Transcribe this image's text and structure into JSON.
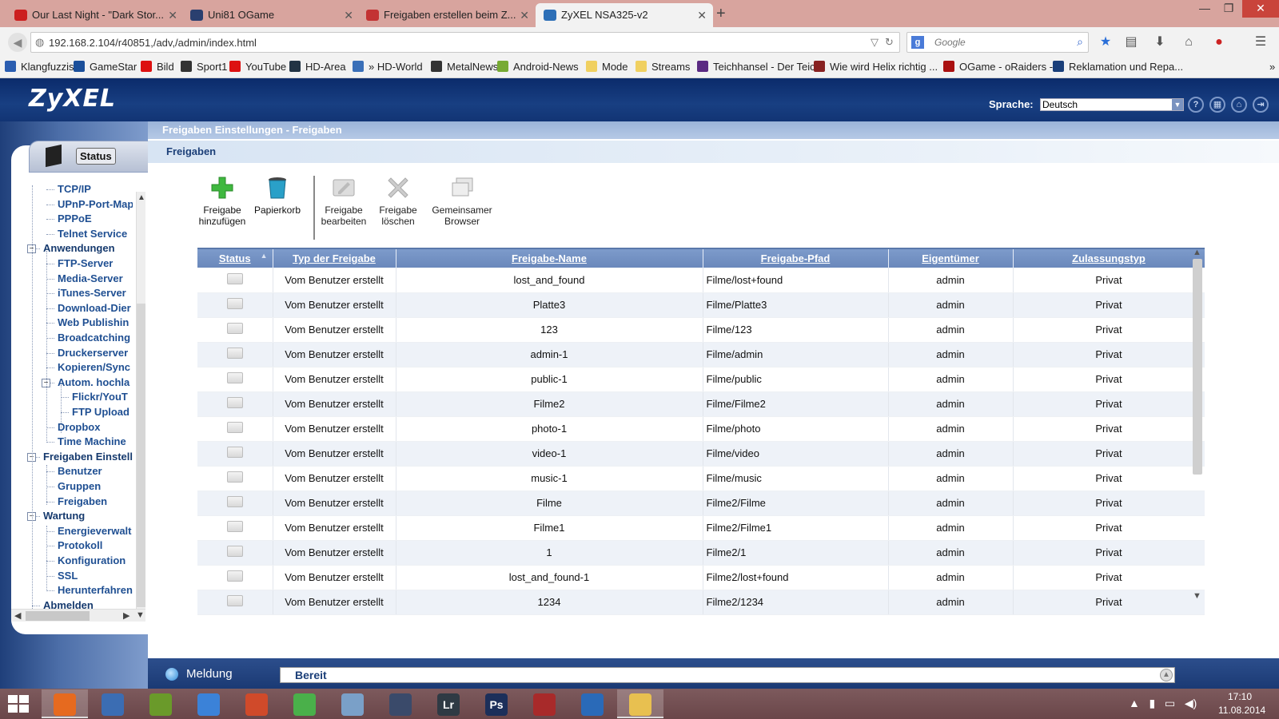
{
  "browser": {
    "tabs": [
      {
        "title": "Our Last Night - \"Dark Stor...",
        "favicon_color": "#cc1f1f"
      },
      {
        "title": "Uni81 OGame",
        "favicon_color": "#2a3f6f"
      },
      {
        "title": "Freigaben erstellen beim Z...",
        "favicon_color": "#c33333"
      },
      {
        "title": "ZyXEL NSA325-v2",
        "favicon_color": "#2d6fb7"
      }
    ],
    "url": "192.168.2.104/r40851,/adv,/admin/index.html",
    "search_placeholder": "Google",
    "bookmarks": [
      {
        "label": "Klangfuzzis",
        "color": "#2a5db0"
      },
      {
        "label": "GameStar",
        "color": "#1b4f9a"
      },
      {
        "label": "Bild",
        "color": "#d11"
      },
      {
        "label": "Sport1",
        "color": "#333"
      },
      {
        "label": "YouTube",
        "color": "#d11"
      },
      {
        "label": "HD-Area",
        "color": "#234"
      },
      {
        "label": "» HD-World",
        "color": "#3a6fb8"
      },
      {
        "label": "MetalNews",
        "color": "#333"
      },
      {
        "label": "Android-News",
        "color": "#7a3"
      },
      {
        "label": "Mode",
        "color": "#f0d060"
      },
      {
        "label": "Streams",
        "color": "#f0d060"
      },
      {
        "label": "Teichhansel - Der Teic...",
        "color": "#5a2a82"
      },
      {
        "label": "Wie wird Helix richtig ...",
        "color": "#822"
      },
      {
        "label": "OGame - oRaiders -",
        "color": "#a11"
      },
      {
        "label": "Reklamation und Repa...",
        "color": "#1a3f7a"
      }
    ]
  },
  "header": {
    "logo": "ZyXEL",
    "language_label": "Sprache:",
    "language_value": "Deutsch"
  },
  "sidebar": {
    "status_label": "Status",
    "items": [
      {
        "label": "TCP/IP",
        "level": 2
      },
      {
        "label": "UPnP-Port-Map",
        "level": 2
      },
      {
        "label": "PPPoE",
        "level": 2
      },
      {
        "label": "Telnet Service",
        "level": 2
      },
      {
        "label": "Anwendungen",
        "level": 1
      },
      {
        "label": "FTP-Server",
        "level": 2
      },
      {
        "label": "Media-Server",
        "level": 2
      },
      {
        "label": "iTunes-Server",
        "level": 2
      },
      {
        "label": "Download-Dier",
        "level": 2
      },
      {
        "label": "Web Publishin",
        "level": 2
      },
      {
        "label": "Broadcatching",
        "level": 2
      },
      {
        "label": "Druckerserver",
        "level": 2
      },
      {
        "label": "Kopieren/Sync",
        "level": 2
      },
      {
        "label": "Autom. hochla",
        "level": 2
      },
      {
        "label": "Flickr/YouT",
        "level": 3
      },
      {
        "label": "FTP Upload",
        "level": 3
      },
      {
        "label": "Dropbox",
        "level": 2
      },
      {
        "label": "Time Machine",
        "level": 2
      },
      {
        "label": "Freigaben Einstell",
        "level": 1
      },
      {
        "label": "Benutzer",
        "level": 2
      },
      {
        "label": "Gruppen",
        "level": 2
      },
      {
        "label": "Freigaben",
        "level": 2
      },
      {
        "label": "Wartung",
        "level": 1
      },
      {
        "label": "Energieverwalt",
        "level": 2
      },
      {
        "label": "Protokoll",
        "level": 2
      },
      {
        "label": "Konfiguration",
        "level": 2
      },
      {
        "label": "SSL",
        "level": 2
      },
      {
        "label": "Herunterfahren",
        "level": 2
      },
      {
        "label": "Abmelden",
        "level": 1
      }
    ]
  },
  "main": {
    "title": "Freigaben Einstellungen - Freigaben",
    "section": "Freigaben",
    "toolbar": {
      "add_line1": "Freigabe",
      "add_line2": "hinzufügen",
      "trash": "Papierkorb",
      "edit_line1": "Freigabe",
      "edit_line2": "bearbeiten",
      "delete_line1": "Freigabe",
      "delete_line2": "löschen",
      "browser_line1": "Gemeinsamer",
      "browser_line2": "Browser"
    },
    "table": {
      "columns": [
        "Status",
        "Typ der Freigabe",
        "Freigabe-Name",
        "Freigabe-Pfad",
        "Eigentümer",
        "Zulassungstyp"
      ],
      "rows": [
        {
          "type": "Vom Benutzer erstellt",
          "name": "lost_and_found",
          "path": "Filme/lost+found",
          "owner": "admin",
          "access": "Privat"
        },
        {
          "type": "Vom Benutzer erstellt",
          "name": "Platte3",
          "path": "Filme/Platte3",
          "owner": "admin",
          "access": "Privat"
        },
        {
          "type": "Vom Benutzer erstellt",
          "name": "123",
          "path": "Filme/123",
          "owner": "admin",
          "access": "Privat"
        },
        {
          "type": "Vom Benutzer erstellt",
          "name": "admin-1",
          "path": "Filme/admin",
          "owner": "admin",
          "access": "Privat"
        },
        {
          "type": "Vom Benutzer erstellt",
          "name": "public-1",
          "path": "Filme/public",
          "owner": "admin",
          "access": "Privat"
        },
        {
          "type": "Vom Benutzer erstellt",
          "name": "Filme2",
          "path": "Filme/Filme2",
          "owner": "admin",
          "access": "Privat"
        },
        {
          "type": "Vom Benutzer erstellt",
          "name": "photo-1",
          "path": "Filme/photo",
          "owner": "admin",
          "access": "Privat"
        },
        {
          "type": "Vom Benutzer erstellt",
          "name": "video-1",
          "path": "Filme/video",
          "owner": "admin",
          "access": "Privat"
        },
        {
          "type": "Vom Benutzer erstellt",
          "name": "music-1",
          "path": "Filme/music",
          "owner": "admin",
          "access": "Privat"
        },
        {
          "type": "Vom Benutzer erstellt",
          "name": "Filme",
          "path": "Filme2/Filme",
          "owner": "admin",
          "access": "Privat"
        },
        {
          "type": "Vom Benutzer erstellt",
          "name": "Filme1",
          "path": "Filme2/Filme1",
          "owner": "admin",
          "access": "Privat"
        },
        {
          "type": "Vom Benutzer erstellt",
          "name": "1",
          "path": "Filme2/1",
          "owner": "admin",
          "access": "Privat"
        },
        {
          "type": "Vom Benutzer erstellt",
          "name": "lost_and_found-1",
          "path": "Filme2/lost+found",
          "owner": "admin",
          "access": "Privat"
        },
        {
          "type": "Vom Benutzer erstellt",
          "name": "1234",
          "path": "Filme2/1234",
          "owner": "admin",
          "access": "Privat"
        }
      ]
    }
  },
  "statusbar": {
    "title": "Meldung",
    "message": "Bereit"
  },
  "taskbar": {
    "apps": [
      {
        "name": "firefox",
        "glyph": "",
        "color": "#e66a1f"
      },
      {
        "name": "thunderbird",
        "glyph": "",
        "color": "#3b6db3"
      },
      {
        "name": "app-green",
        "glyph": "",
        "color": "#6a9a2a"
      },
      {
        "name": "app-blue-disc",
        "glyph": "",
        "color": "#3b82d8"
      },
      {
        "name": "app-pen",
        "glyph": "",
        "color": "#d04a2a"
      },
      {
        "name": "app-man",
        "glyph": "",
        "color": "#4ab04a"
      },
      {
        "name": "app-file",
        "glyph": "",
        "color": "#7aa0c8"
      },
      {
        "name": "app-steam",
        "glyph": "",
        "color": "#3a4a6a"
      },
      {
        "name": "lightroom",
        "glyph": "Lr",
        "color": "#2f3a44"
      },
      {
        "name": "photoshop",
        "glyph": "Ps",
        "color": "#1c2f5a"
      },
      {
        "name": "app-red",
        "glyph": "",
        "color": "#a82a2a"
      },
      {
        "name": "app-blue-shell",
        "glyph": "",
        "color": "#2a6ab8"
      },
      {
        "name": "explorer",
        "glyph": "",
        "color": "#e8c050"
      }
    ],
    "time": "17:10",
    "date": "11.08.2014"
  }
}
